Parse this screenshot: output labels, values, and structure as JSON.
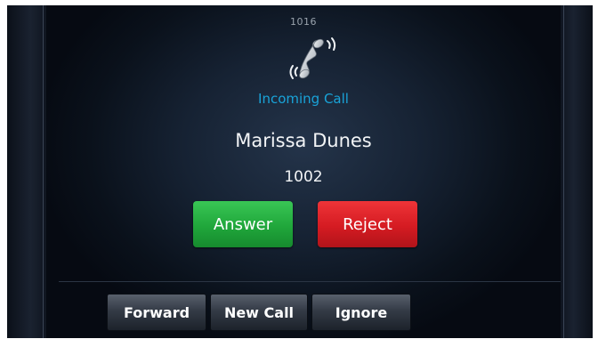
{
  "line": {
    "label": "1016"
  },
  "call": {
    "status": "Incoming Call",
    "caller_name": "Marissa Dunes",
    "caller_number": "1002",
    "icon": "ringing-handset-icon"
  },
  "actions": {
    "answer_label": "Answer",
    "reject_label": "Reject"
  },
  "softkeys": [
    "Forward",
    "New Call",
    "Ignore"
  ],
  "colors": {
    "status_text": "#19a3d8",
    "answer": "#20a73b",
    "reject": "#d51b22",
    "background": "#060a12"
  }
}
